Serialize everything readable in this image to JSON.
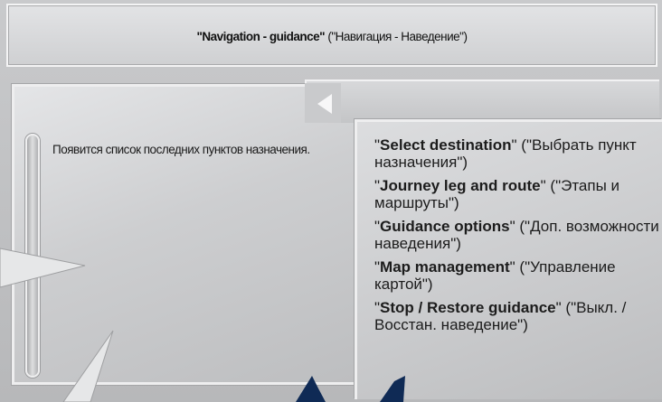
{
  "header": {
    "title_en": "\"Navigation - guidance\"",
    "title_ru": " (\"Навигация - Наведение\")"
  },
  "left_panel": {
    "message": "Появится список последних пунктов назначения."
  },
  "menu": {
    "items": [
      {
        "en": "Select destination",
        "ru": " (\"Выбрать пункт назначения\")"
      },
      {
        "en": "Journey leg and route",
        "ru": " (\"Этапы и маршруты\")"
      },
      {
        "en": "Guidance options",
        "ru": " (\"Доп. возможности наведения\")"
      },
      {
        "en": "Map management",
        "ru": " (\"Управление картой\")"
      },
      {
        "en": "Stop / Restore guidance",
        "ru": " (\"Выкл. / Восстан. наведение\")"
      }
    ]
  },
  "icons": {
    "back": "back-arrow-icon"
  },
  "colors": {
    "background": "#c6c7c9",
    "panel": "#d7d8da",
    "text": "#1a1a1a",
    "arrow": "#0f2a55"
  }
}
